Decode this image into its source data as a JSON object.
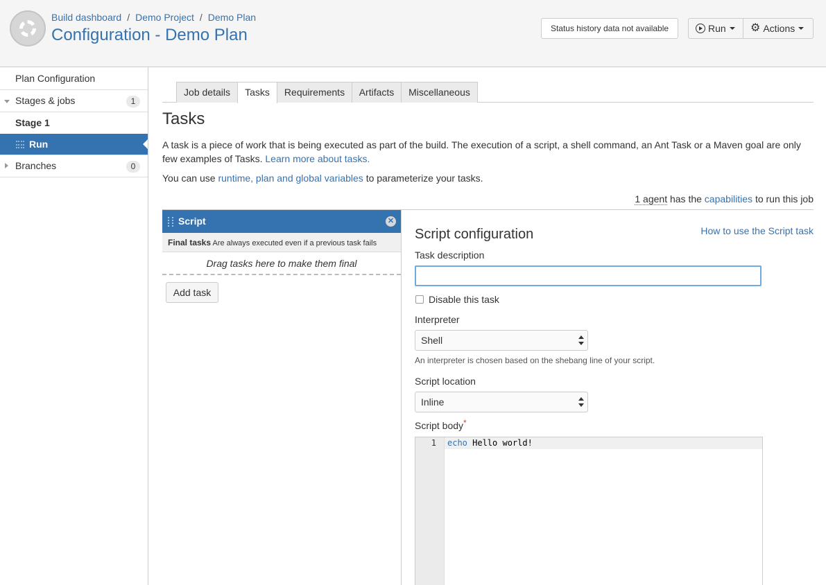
{
  "header": {
    "breadcrumbs": [
      "Build dashboard",
      "Demo Project",
      "Demo Plan"
    ],
    "breadcrumb_separator": "/",
    "title": "Configuration - Demo Plan",
    "status_text": "Status history data not available",
    "run_label": "Run",
    "actions_label": "Actions"
  },
  "sidebar": {
    "plan_configuration": "Plan Configuration",
    "stages_jobs": "Stages & jobs",
    "stages_count": "1",
    "stage_name": "Stage 1",
    "job_name": "Run",
    "branches": "Branches",
    "branches_count": "0"
  },
  "tabs": [
    "Job details",
    "Tasks",
    "Requirements",
    "Artifacts",
    "Miscellaneous"
  ],
  "active_tab": "Tasks",
  "content": {
    "heading": "Tasks",
    "intro_text": "A task is a piece of work that is being executed as part of the build. The execution of a script, a shell command, an Ant Task or a Maven goal are only few examples of Tasks. ",
    "intro_link": "Learn more about tasks.",
    "vars_prefix": "You can use ",
    "vars_link": "runtime, plan and global variables",
    "vars_suffix": " to parameterize your tasks.",
    "agent_count": "1 agent",
    "agent_mid": " has the ",
    "agent_link": "capabilities",
    "agent_suffix": " to run this job"
  },
  "task_list": {
    "task_name": "Script",
    "final_label": "Final tasks",
    "final_desc": "Are always executed even if a previous task fails",
    "drag_hint": "Drag tasks here to make them final",
    "add_task": "Add task"
  },
  "config": {
    "title": "Script configuration",
    "help_link": "How to use the Script task",
    "task_description_label": "Task description",
    "task_description_value": "",
    "disable_label": "Disable this task",
    "interpreter_label": "Interpreter",
    "interpreter_value": "Shell",
    "interpreter_help": "An interpreter is chosen based on the shebang line of your script.",
    "location_label": "Script location",
    "location_value": "Inline",
    "body_label": "Script body",
    "required_mark": "*",
    "editor": {
      "line_number": "1",
      "code_keyword": "echo",
      "code_rest": " Hello world!"
    }
  }
}
